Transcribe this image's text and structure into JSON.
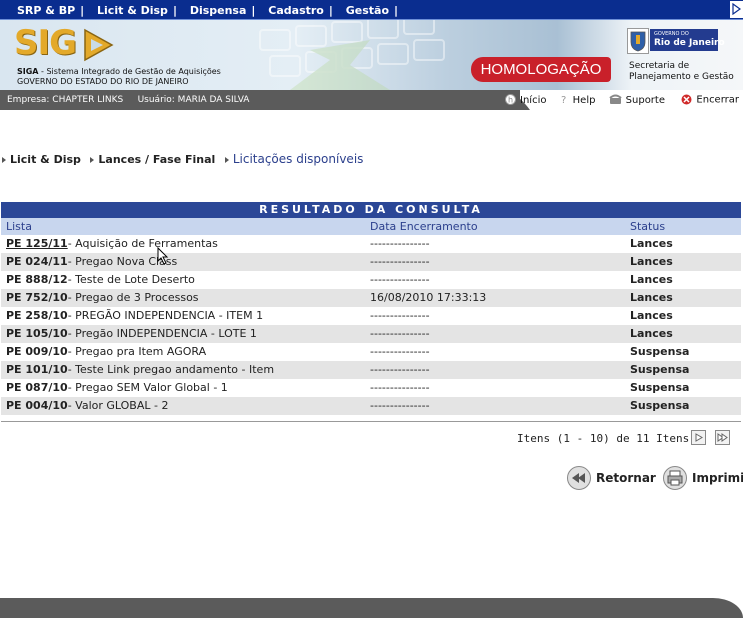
{
  "top_menu": {
    "items": [
      "SRP & BP",
      "Licit & Disp",
      "Dispensa",
      "Cadastro",
      "Gestão"
    ]
  },
  "banner": {
    "logo_text": "SIG",
    "line1_bold": "SIGA",
    "line1_rest": " - Sistema Integrado de Gestão de Aquisições",
    "line2": "GOVERNO DO ESTADO DO RIO DE JANEIRO",
    "environment_badge": "HOMOLOGAÇÃO",
    "gov_small": "GOVERNO DO",
    "gov_name": "Rio de Janeiro",
    "secretaria_line1": "Secretaria de",
    "secretaria_line2": "Planejamento e Gestão"
  },
  "infobar": {
    "empresa": "Empresa: CHAPTER LINKS",
    "usuario": "Usuário: MARIA DA SILVA",
    "inicio": "Início",
    "help": "Help",
    "suporte": "Suporte",
    "encerrar": "Encerrar"
  },
  "breadcrumb": {
    "item1": "Licit & Disp",
    "item2": "Lances / Fase Final",
    "current": "Licitações disponíveis"
  },
  "results": {
    "title": "RESULTADO DA CONSULTA",
    "columns": {
      "lista": "Lista",
      "data": "Data Encerramento",
      "status": "Status"
    },
    "rows": [
      {
        "code": "PE 125/11",
        "desc": " - Aquisição de Ferramentas",
        "date": "---------------",
        "status": "Lances"
      },
      {
        "code": "PE 024/11",
        "desc": " - Pregao Nova Class",
        "date": "---------------",
        "status": "Lances"
      },
      {
        "code": "PE 888/12",
        "desc": " - Teste de Lote Deserto",
        "date": "---------------",
        "status": "Lances"
      },
      {
        "code": "PE 752/10",
        "desc": " - Pregao de 3 Processos",
        "date": "16/08/2010 17:33:13",
        "status": "Lances"
      },
      {
        "code": "PE 258/10",
        "desc": " - PREGÃO INDEPENDENCIA - ITEM 1",
        "date": "---------------",
        "status": "Lances"
      },
      {
        "code": "PE 105/10",
        "desc": " - Pregão INDEPENDENCIA - LOTE 1",
        "date": "---------------",
        "status": "Lances"
      },
      {
        "code": "PE 009/10",
        "desc": " - Pregao pra Item AGORA",
        "date": "---------------",
        "status": "Suspensa"
      },
      {
        "code": "PE 101/10",
        "desc": " - Teste Link pregao andamento - Item",
        "date": "---------------",
        "status": "Suspensa"
      },
      {
        "code": "PE 087/10",
        "desc": " - Pregao SEM Valor Global - 1",
        "date": "---------------",
        "status": "Suspensa"
      },
      {
        "code": "PE 004/10",
        "desc": " - Valor GLOBAL - 2",
        "date": "---------------",
        "status": "Suspensa"
      }
    ],
    "pager_text": "Itens (1 - 10) de 11 Itens"
  },
  "actions": {
    "retornar": "Retornar",
    "imprimir": "Imprimir"
  }
}
